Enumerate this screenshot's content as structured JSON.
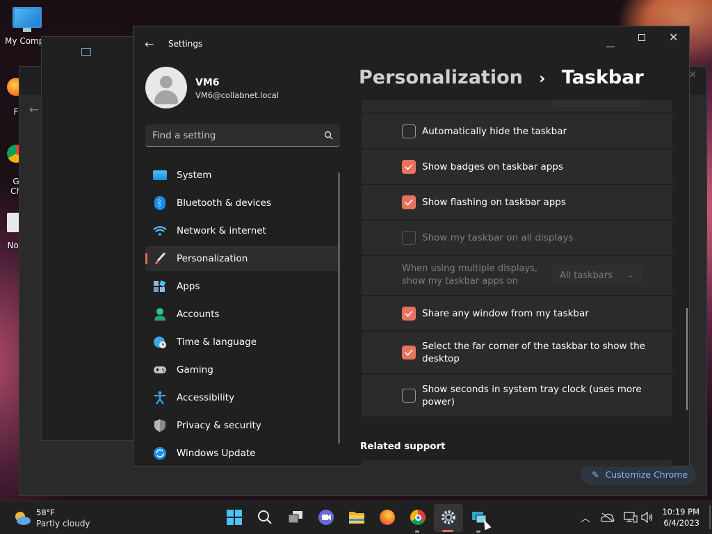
{
  "desktop": {
    "icons": [
      {
        "label": "My Compu"
      },
      {
        "label": "F"
      },
      {
        "label": "G"
      },
      {
        "label": "Ch"
      },
      {
        "label": "Not"
      }
    ]
  },
  "window": {
    "title": "Settings"
  },
  "user": {
    "name": "VM6",
    "email": "VM6@collabnet.local"
  },
  "search": {
    "placeholder": "Find a setting"
  },
  "nav": [
    {
      "label": "System",
      "icon": "system-icon"
    },
    {
      "label": "Bluetooth & devices",
      "icon": "bluetooth-icon"
    },
    {
      "label": "Network & internet",
      "icon": "wifi-icon"
    },
    {
      "label": "Personalization",
      "icon": "brush-icon",
      "selected": true
    },
    {
      "label": "Apps",
      "icon": "apps-icon"
    },
    {
      "label": "Accounts",
      "icon": "account-icon"
    },
    {
      "label": "Time & language",
      "icon": "globe-clock-icon"
    },
    {
      "label": "Gaming",
      "icon": "gamepad-icon"
    },
    {
      "label": "Accessibility",
      "icon": "accessibility-icon"
    },
    {
      "label": "Privacy & security",
      "icon": "shield-icon"
    },
    {
      "label": "Windows Update",
      "icon": "update-icon"
    }
  ],
  "breadcrumb": {
    "parent": "Personalization",
    "separator": "›",
    "current": "Taskbar"
  },
  "options": [
    {
      "label": "Automatically hide the taskbar",
      "checked": false
    },
    {
      "label": "Show badges on taskbar apps",
      "checked": true
    },
    {
      "label": "Show flashing on taskbar apps",
      "checked": true
    },
    {
      "label": "Show my taskbar on all displays",
      "checked": false,
      "disabled": true
    },
    {
      "label1": "When using multiple displays,",
      "label2": "show my taskbar apps on",
      "value": "All taskbars",
      "disabled": true
    },
    {
      "label": "Share any window from my taskbar",
      "checked": true
    },
    {
      "label1": "Select the far corner of the taskbar to show the",
      "label2": "desktop",
      "checked": true
    },
    {
      "label1": "Show seconds in system tray clock (uses more",
      "label2": "power)",
      "checked": false
    }
  ],
  "related": {
    "title": "Related support"
  },
  "chrome": {
    "customize": "Customize Chrome"
  },
  "weather": {
    "temp": "58°F",
    "desc": "Partly cloudy"
  },
  "clock": {
    "time": "10:19 PM",
    "date": "6/4/2023"
  },
  "colors": {
    "accent": "#e8725f",
    "window_bg": "#202020",
    "card_bg": "#2b2b2b"
  }
}
